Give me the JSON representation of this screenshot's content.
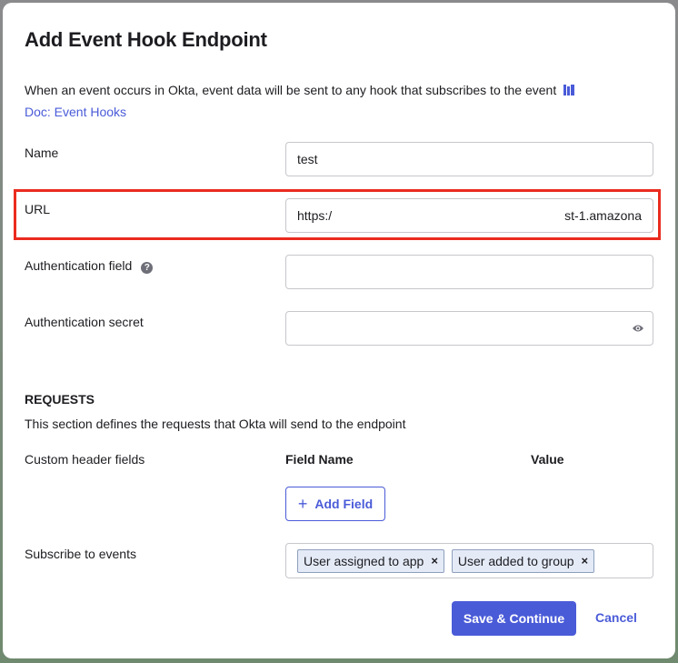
{
  "modal": {
    "title": "Add Event Hook Endpoint",
    "intro_text": "When an event occurs in Okta, event data will be sent to any hook that subscribes to the event",
    "doc_link": "Doc: Event Hooks",
    "doc_icon": "book-icon"
  },
  "form": {
    "name": {
      "label": "Name",
      "value": "test"
    },
    "url": {
      "label": "URL",
      "value": "https:/",
      "value_tail": "st-1.amazona"
    },
    "auth_field": {
      "label": "Authentication field",
      "value": "",
      "help_icon": "question-circle-icon"
    },
    "auth_secret": {
      "label": "Authentication secret",
      "value": "",
      "reveal_icon": "eye-icon"
    }
  },
  "requests": {
    "title": "REQUESTS",
    "description": "This section defines the requests that Okta will send to the endpoint",
    "custom_header_label": "Custom header fields",
    "col_field_name": "Field Name",
    "col_value": "Value",
    "add_field_label": "Add Field"
  },
  "subscribe": {
    "label": "Subscribe to events",
    "chips": [
      {
        "label": "User assigned to app",
        "remove": "×"
      },
      {
        "label": "User added to group",
        "remove": "×"
      }
    ]
  },
  "footer": {
    "save_label": "Save & Continue",
    "cancel_label": "Cancel"
  },
  "colors": {
    "accent": "#4a5bd8",
    "highlight": "#ea2b1f",
    "chip_bg": "#e4ebf7"
  }
}
